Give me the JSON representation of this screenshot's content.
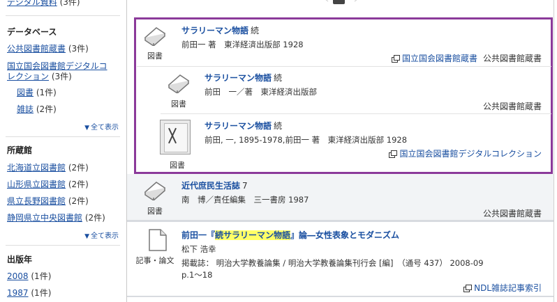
{
  "sidebar": {
    "top_partial": {
      "label": "デジタル資料",
      "count": "(3件)"
    },
    "database": {
      "title": "データベース",
      "items": [
        {
          "label": "公共図書館蔵書",
          "count": "(3件)"
        },
        {
          "label_line1": "国立国会図書館デジタルコ",
          "label_line2": "レクション",
          "count": "(3件)"
        }
      ],
      "sub_items": [
        {
          "label": "図書",
          "count": "(1件)"
        },
        {
          "label": "雑誌",
          "count": "(2件)"
        }
      ],
      "show_all": "全て表示"
    },
    "holdings": {
      "title": "所蔵館",
      "items": [
        {
          "label": "北海道立図書館",
          "count": "(2件)"
        },
        {
          "label": "山形県立図書館",
          "count": "(2件)"
        },
        {
          "label": "県立長野図書館",
          "count": "(2件)"
        },
        {
          "label": "静岡県立中央図書館",
          "count": "(2件)"
        }
      ],
      "show_all": "全て表示"
    },
    "year": {
      "title": "出版年",
      "items": [
        {
          "label": "2008",
          "count": "(1件)"
        },
        {
          "label": "1987",
          "count": "(1件)"
        }
      ]
    }
  },
  "results": {
    "group": [
      {
        "type": "図書",
        "title": "サラリーマン物語",
        "suffix": "続",
        "meta": "前田一 著　東洋経済出版部 1928",
        "source_link": "国立国会図書館蔵書",
        "source_plain": "公共図書館蔵書"
      },
      {
        "type": "図書",
        "title": "サラリーマン物語",
        "suffix": "続",
        "meta": "前田　一／著　東洋経済出版部",
        "source_plain": "公共図書館蔵書"
      },
      {
        "type": "図書",
        "title": "サラリーマン物語",
        "suffix": "続",
        "meta": "前田, 一, 1895-1978,前田一 著　東洋経済出版部 1928",
        "source_link": "国立国会図書館デジタルコレクション"
      }
    ],
    "item4": {
      "type": "図書",
      "title": "近代庶民生活誌",
      "suffix": "7",
      "meta": "南　博／責任編集　三一書房 1987",
      "source_plain": "公共図書館蔵書"
    },
    "item5": {
      "type": "記事・論文",
      "title_pre": "前田一『",
      "title_hl": "続サラリーマン物語",
      "title_post": "』論―女性表象とモダニズム",
      "author": "松下 浩幸",
      "journal": "掲載誌：  明治大学教養論集 / 明治大学教養論集刊行会 [編]　（通号 437）  2008-09",
      "pages": "p.1～18",
      "source_link": "NDL雑誌記事索引"
    }
  },
  "colors": {
    "link": "#1a4fa0",
    "group_border": "#8b3a9a",
    "highlight": "#ffff66"
  },
  "icons": [
    "book-icon",
    "document-icon",
    "external-link-icon",
    "triangle-down-icon"
  ]
}
